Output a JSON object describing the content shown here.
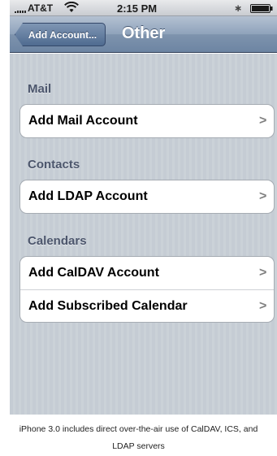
{
  "status_bar": {
    "carrier": "AT&T",
    "time": "2:15 PM"
  },
  "nav": {
    "back_label": "Add Account...",
    "title": "Other"
  },
  "sections": [
    {
      "header": "Mail",
      "items": [
        {
          "label": "Add Mail Account"
        }
      ]
    },
    {
      "header": "Contacts",
      "items": [
        {
          "label": "Add LDAP Account"
        }
      ]
    },
    {
      "header": "Calendars",
      "items": [
        {
          "label": "Add CalDAV Account"
        },
        {
          "label": "Add Subscribed Calendar"
        }
      ]
    }
  ],
  "chevron_glyph": ">",
  "caption": {
    "line1": "iPhone 3.0 includes direct over-the-air use of CalDAV, ICS, and",
    "line2": "LDAP servers"
  },
  "colors": {
    "nav_blue": "#6d85a3",
    "table_background": "#c5ccd4",
    "section_header_text": "#4c566c"
  }
}
